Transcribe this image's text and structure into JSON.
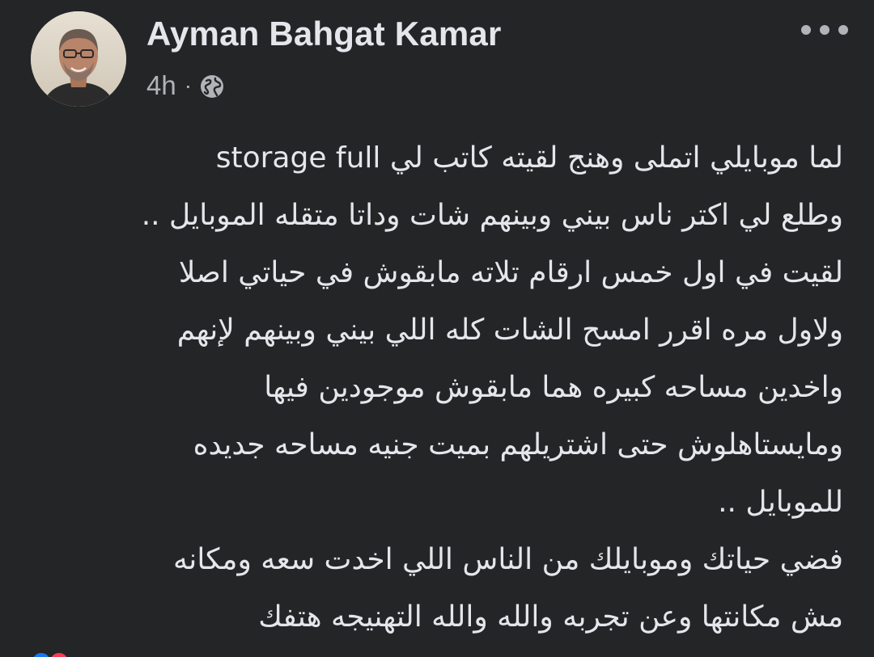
{
  "post": {
    "author": {
      "name": "Ayman Bahgat Kamar"
    },
    "time": "4h",
    "separator": "·",
    "privacy_icon": "globe-icon",
    "more_icon": "more-horizontal-icon",
    "text_lines": [
      "لما موبايلي اتملى وهنج لقيته كاتب لي   storage full",
      "وطلع لي اكتر ناس بيني وبينهم شات وداتا متقله الموبايل ..",
      "لقيت في اول خمس ارقام  تلاته مابقوش في حياتي اصلا",
      "ولاول مره اقرر امسح الشات كله اللي بيني وبينهم  لإنهم",
      "واخدين مساحه كبيره هما مابقوش موجودين فيها",
      "ومايستاهلوش حتى اشتريلهم بميت جنيه مساحه جديده",
      "للموبايل ..",
      "فضي حياتك وموبايلك من الناس اللي اخدت سعه ومكانه",
      "مش مكانتها وعن تجربه والله والله التهنيجه هتفك"
    ]
  },
  "colors": {
    "background": "#242526",
    "primary_text": "#e4e6eb",
    "secondary_text": "#b0b3b8"
  }
}
